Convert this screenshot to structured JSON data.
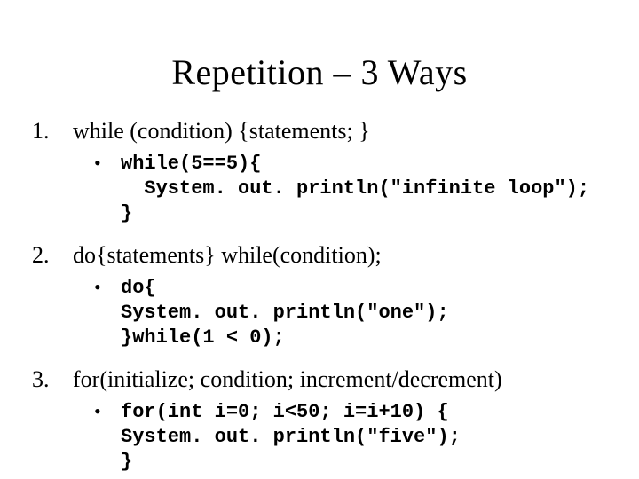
{
  "title": "Repetition – 3 Ways",
  "items": [
    {
      "num": "1.",
      "text": "while (condition) {statements; }",
      "bullet": "•",
      "code": "while(5==5){\n  System. out. println(\"infinite loop\");\n}"
    },
    {
      "num": "2.",
      "text": "do{statements} while(condition);",
      "bullet": "•",
      "code": "do{\nSystem. out. println(\"one\");\n}while(1 < 0);"
    },
    {
      "num": "3.",
      "text": "for(initialize; condition; increment/decrement)",
      "bullet": "•",
      "code": "for(int i=0; i<50; i=i+10) {\nSystem. out. println(\"five\");\n}"
    }
  ]
}
